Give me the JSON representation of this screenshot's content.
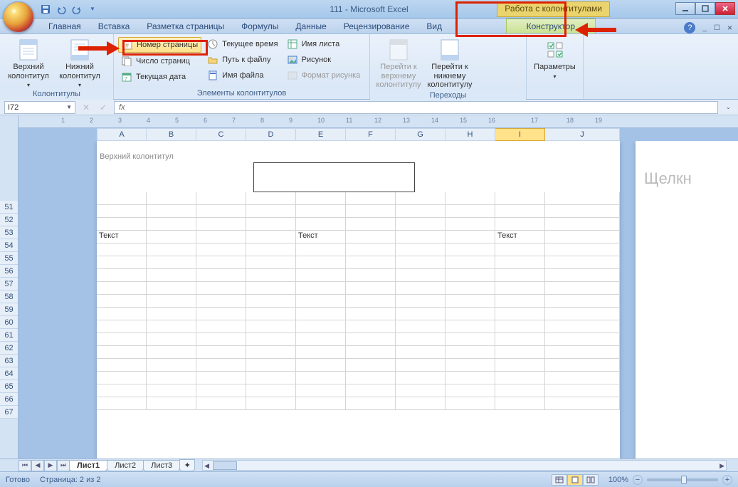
{
  "title": "111 - Microsoft Excel",
  "context_group": "Работа с колонтитулами",
  "tabs": {
    "t0": "Главная",
    "t1": "Вставка",
    "t2": "Разметка страницы",
    "t3": "Формулы",
    "t4": "Данные",
    "t5": "Рецензирование",
    "t6": "Вид",
    "ctx": "Конструктор"
  },
  "ribbon": {
    "g1": {
      "label": "Колонтитулы",
      "b1": "Верхний колонтитул",
      "b2": "Нижний колонтитул"
    },
    "g2": {
      "label": "Элементы колонтитулов",
      "c1": "Номер страницы",
      "c2": "Число страниц",
      "c3": "Текущая дата",
      "c4": "Текущее время",
      "c5": "Путь к файлу",
      "c6": "Имя файла",
      "c7": "Имя листа",
      "c8": "Рисунок",
      "c9": "Формат рисунка"
    },
    "g3": {
      "label": "Переходы",
      "b1": "Перейти к верхнему колонтитулу",
      "b2": "Перейти к нижнему колонтитулу"
    },
    "g4": {
      "label": "",
      "b1": "Параметры"
    }
  },
  "namebox": "I72",
  "fx": "",
  "cols": [
    "A",
    "B",
    "C",
    "D",
    "E",
    "F",
    "G",
    "H",
    "I",
    "J"
  ],
  "rows": [
    "51",
    "52",
    "53",
    "54",
    "55",
    "56",
    "57",
    "58",
    "59",
    "60",
    "61",
    "62",
    "63",
    "64",
    "65",
    "66",
    "67"
  ],
  "ruler_ticks": [
    "1",
    "2",
    "3",
    "4",
    "5",
    "6",
    "7",
    "8",
    "9",
    "10",
    "11",
    "12",
    "13",
    "14",
    "15",
    "16",
    "17",
    "18",
    "19"
  ],
  "header_label": "Верхний колонтитул",
  "cells": {
    "a54": "Текст",
    "e54": "Текст",
    "i54": "Текст"
  },
  "side_hint": "Щелкн",
  "sheets": {
    "s1": "Лист1",
    "s2": "Лист2",
    "s3": "Лист3"
  },
  "status": {
    "ready": "Готово",
    "page": "Страница: 2 из 2",
    "zoom": "100%"
  }
}
